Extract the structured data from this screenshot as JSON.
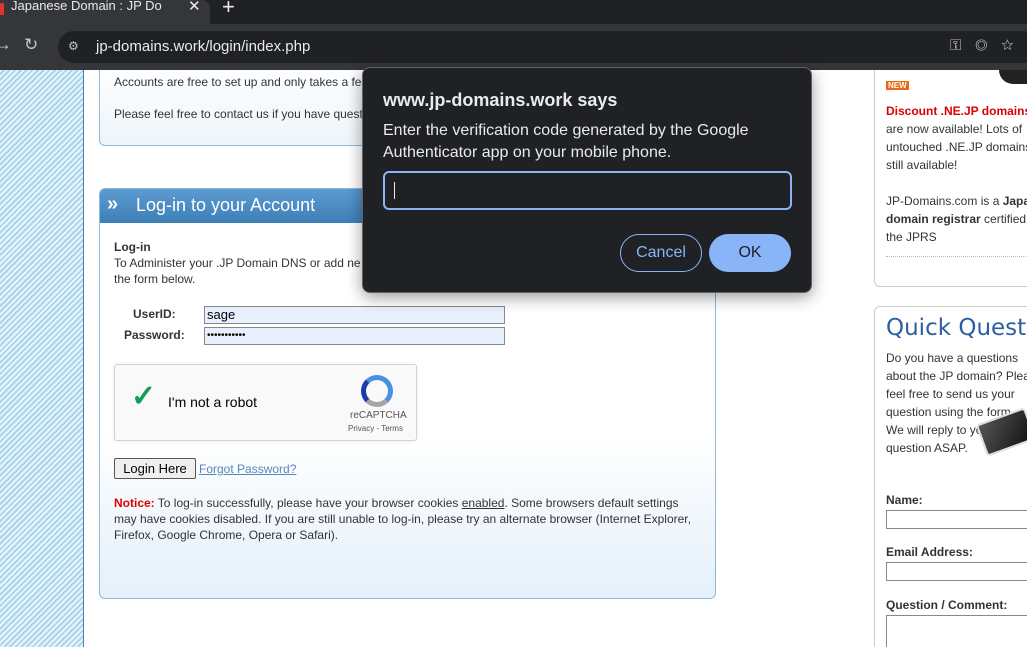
{
  "browser": {
    "tab_title": "Japanese Domain : JP Do",
    "url": "jp-domains.work/login/index.php"
  },
  "intro": {
    "line1": "Accounts are free to set up and only takes a fe",
    "line2": "Please feel free to contact us if you have quest"
  },
  "login": {
    "title": "Log-in to your Account",
    "section_label": "Log-in",
    "desc_line1": "To Administer your .JP Domain DNS or add ne",
    "desc_line2": "the form below.",
    "userid_label": "UserID:",
    "userid_value": "sage",
    "password_label": "Password:",
    "password_value": "•••••••••••",
    "captcha_label": "I'm not a robot",
    "captcha_brand": "reCAPTCHA",
    "captcha_links": "Privacy - Terms",
    "login_button": "Login Here",
    "forgot_link": "Forgot Password?",
    "notice_label": "Notice:",
    "notice_pre": " To log-in successfully, please have your browser cookies ",
    "notice_enabled": "enabled",
    "notice_post": ". Some browsers default settings may have cookies disabled. If you are still unable to log-in, please try an alternate browser (Internet Explorer, Firefox, Google Chrome, Opera or Safari)."
  },
  "sidebar": {
    "new_badge": "NEW",
    "discount_title": "Discount .NE.JP domains",
    "discount_text": "are now available! Lots of untouched .NE.JP domains still available!",
    "registrar_pre": "JP-Domains.com is a ",
    "registrar_bold": "Japa domain registrar",
    "registrar_post": " certified the JPRS",
    "quick_title": "Quick Question",
    "quick_text": "Do you have a questions about the JP domain? Plea feel free to send us your question using the form. We will reply to your question ASAP.",
    "name_label": "Name:",
    "email_label": "Email Address:",
    "question_label": "Question / Comment:"
  },
  "dialog": {
    "title": "www.jp-domains.work says",
    "message": "Enter the verification code generated by the Google Authenticator app on your mobile phone.",
    "input_value": "",
    "cancel_label": "Cancel",
    "ok_label": "OK"
  }
}
